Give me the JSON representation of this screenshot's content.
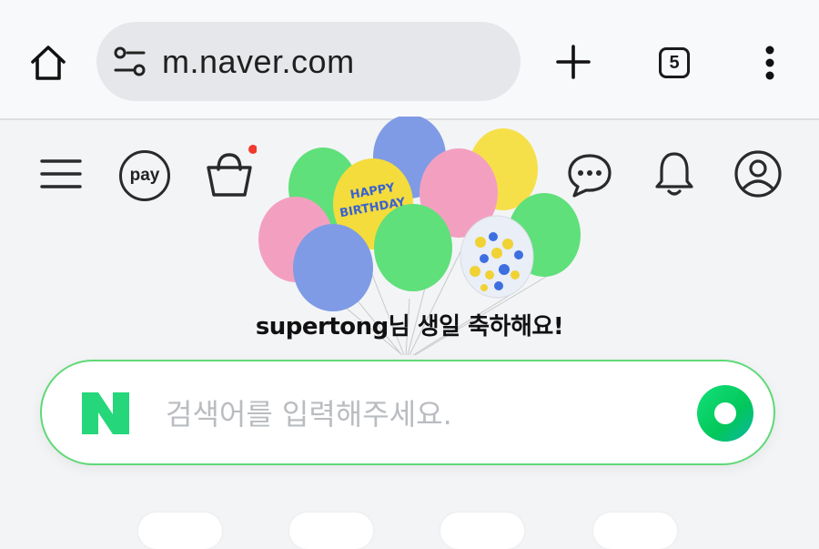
{
  "browser": {
    "url": "m.naver.com",
    "tab_count": "5",
    "icons": {
      "home": "home-icon",
      "site_settings": "tune-icon",
      "new_tab": "plus-icon",
      "tabs": "tabs-icon",
      "menu": "more-vert-icon"
    }
  },
  "header": {
    "pay_label": "pay",
    "icons": [
      "menu-icon",
      "pay-icon",
      "cart-icon",
      "chat-icon",
      "bell-icon",
      "profile-icon"
    ],
    "cart_badge_color": "#f03a2e"
  },
  "celebration": {
    "balloon_text": "HAPPY BIRTHDAY",
    "message": "supertong님 생일 축하해요!"
  },
  "search": {
    "placeholder": "검색어를 입력해주세요.",
    "logo_letter": "N",
    "border_color": "#5fd977",
    "brand_green": "#03c75a"
  }
}
